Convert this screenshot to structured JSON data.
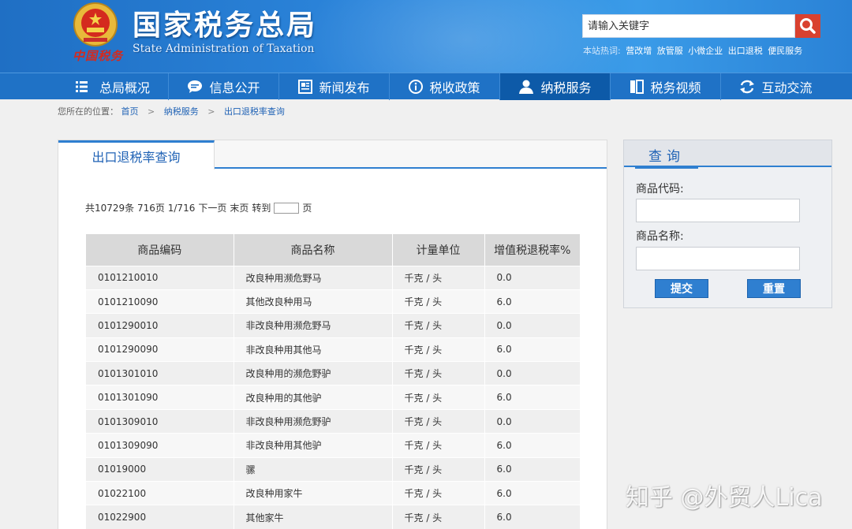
{
  "header": {
    "title": "国家税务总局",
    "subtitle": "State Administration of Taxation",
    "emblem_caption": "中国税务",
    "search": {
      "placeholder": "请输入关键字"
    },
    "hot": {
      "label": "本站热词:",
      "items": [
        "营改增",
        "放管服",
        "小微企业",
        "出口退税",
        "便民服务"
      ]
    }
  },
  "nav": {
    "items": [
      {
        "label": "总局概况",
        "icon": "menu-icon"
      },
      {
        "label": "信息公开",
        "icon": "chat-bubble-icon"
      },
      {
        "label": "新闻发布",
        "icon": "newspaper-icon"
      },
      {
        "label": "税收政策",
        "icon": "info-icon"
      },
      {
        "label": "纳税服务",
        "icon": "user-icon",
        "active": true
      },
      {
        "label": "税务视频",
        "icon": "video-book-icon"
      },
      {
        "label": "互动交流",
        "icon": "exchange-icon"
      }
    ]
  },
  "breadcrumb": {
    "prefix": "您所在的位置：",
    "items": [
      "首页",
      "纳税服务",
      "出口退税率查询"
    ],
    "separator": ">"
  },
  "main": {
    "tab": "出口退税率查询",
    "pager": {
      "total": "共10729条",
      "pages": "716页",
      "current": "1/716",
      "next": "下一页",
      "last": "末页",
      "goto": "转到",
      "unit": "页"
    },
    "table": {
      "headers": [
        "商品编码",
        "商品名称",
        "计量单位",
        "增值税退税率%"
      ],
      "rows": [
        [
          "0101210010",
          "改良种用濒危野马",
          "千克 / 头",
          "0.0"
        ],
        [
          "0101210090",
          "其他改良种用马",
          "千克 / 头",
          "6.0"
        ],
        [
          "0101290010",
          "非改良种用濒危野马",
          "千克 / 头",
          "0.0"
        ],
        [
          "0101290090",
          "非改良种用其他马",
          "千克 / 头",
          "6.0"
        ],
        [
          "0101301010",
          "改良种用的濒危野驴",
          "千克 / 头",
          "0.0"
        ],
        [
          "0101301090",
          "改良种用的其他驴",
          "千克 / 头",
          "6.0"
        ],
        [
          "0101309010",
          "非改良种用濒危野驴",
          "千克 / 头",
          "0.0"
        ],
        [
          "0101309090",
          "非改良种用其他驴",
          "千克 / 头",
          "6.0"
        ],
        [
          "01019000",
          "骡",
          "千克 / 头",
          "6.0"
        ],
        [
          "01022100",
          "改良种用家牛",
          "千克 / 头",
          "6.0"
        ],
        [
          "01022900",
          "其他家牛",
          "千克 / 头",
          "6.0"
        ]
      ]
    }
  },
  "side": {
    "title": "查询",
    "code_label": "商品代码:",
    "name_label": "商品名称:",
    "submit": "提交",
    "reset": "重置"
  },
  "watermark": "知乎 @外贸人Lica",
  "colors": {
    "header_blue": "#2c86dc",
    "nav_blue": "#1f72c6",
    "active_nav": "#0d5aa8",
    "accent": "#2f7fd0",
    "search_red": "#d9412f"
  }
}
